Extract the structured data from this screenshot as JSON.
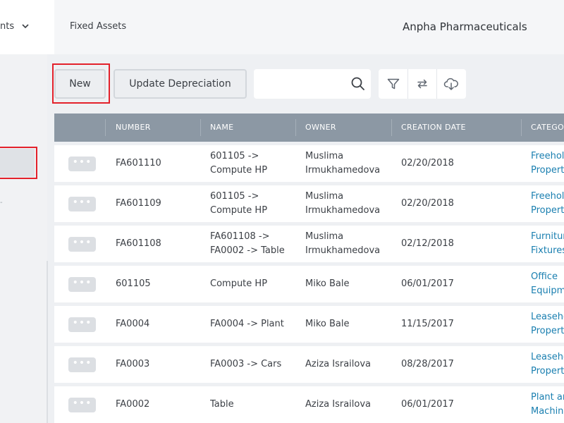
{
  "topbar": {
    "nav_left_label": "nts",
    "module_title": "Fixed Assets",
    "company_name": "Anpha Pharmaceuticals"
  },
  "sidebar": {
    "mark": "-"
  },
  "toolbar": {
    "new_label": "New",
    "update_depreciation_label": "Update Depreciation",
    "search_placeholder": "",
    "icons": [
      "filter-icon",
      "swap-icon",
      "cloud-download-icon"
    ]
  },
  "table": {
    "columns": [
      "",
      "NUMBER",
      "NAME",
      "OWNER",
      "CREATION DATE",
      "CATEGORY"
    ],
    "rows": [
      {
        "menu": "•••",
        "number": "FA601110",
        "name": [
          "601105 ->",
          "Compute HP"
        ],
        "owner": [
          "Muslima",
          "Irmukhamedova"
        ],
        "date": "02/20/2018",
        "category": [
          "Freehold",
          "Property"
        ]
      },
      {
        "menu": "•••",
        "number": "FA601109",
        "name": [
          "601105 ->",
          "Compute HP"
        ],
        "owner": [
          "Muslima",
          "Irmukhamedova"
        ],
        "date": "02/20/2018",
        "category": [
          "Freehold",
          "Property"
        ]
      },
      {
        "menu": "•••",
        "number": "FA601108",
        "name": [
          "FA601108 ->",
          "FA0002 -> Table"
        ],
        "owner": [
          "Muslima",
          "Irmukhamedova"
        ],
        "date": "02/12/2018",
        "category": [
          "Furniture &",
          "Fixtures"
        ]
      },
      {
        "menu": "•••",
        "number": "601105",
        "name": [
          "Compute HP"
        ],
        "owner": [
          "Miko Bale"
        ],
        "date": "06/01/2017",
        "category": [
          "Office",
          "Equipment"
        ]
      },
      {
        "menu": "•••",
        "number": "FA0004",
        "name": [
          "FA0004 -> Plant"
        ],
        "owner": [
          "Miko Bale"
        ],
        "date": "11/15/2017",
        "category": [
          "Leasehold",
          "Property"
        ]
      },
      {
        "menu": "•••",
        "number": "FA0003",
        "name": [
          "FA0003 -> Cars"
        ],
        "owner": [
          "Aziza Israilova"
        ],
        "date": "08/28/2017",
        "category": [
          "Leasehold",
          "Property"
        ]
      },
      {
        "menu": "•••",
        "number": "FA0002",
        "name": [
          "Table"
        ],
        "owner": [
          "Aziza Israilova"
        ],
        "date": "06/01/2017",
        "category": [
          "Plant and",
          "Machinery"
        ]
      }
    ]
  },
  "colors": {
    "header_bg": "#8c98a4",
    "category_link": "#1a7fb0",
    "highlight_red": "#e3212b"
  }
}
